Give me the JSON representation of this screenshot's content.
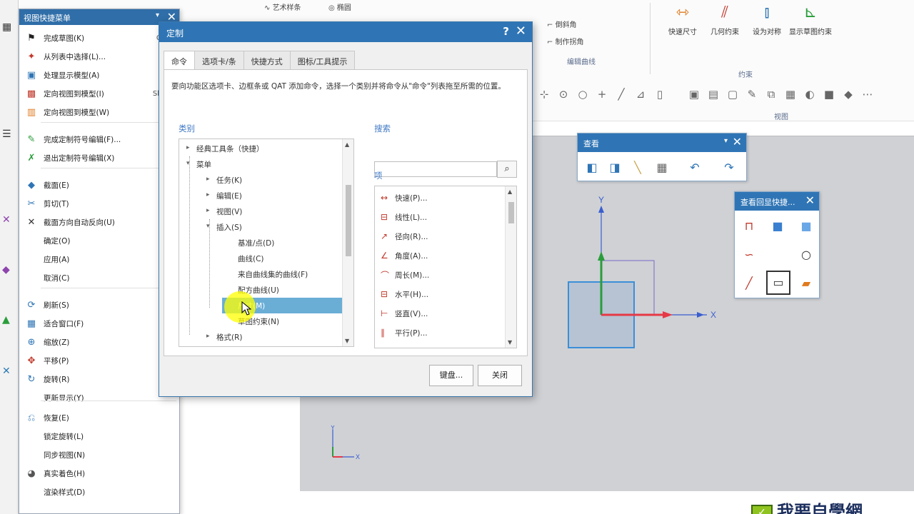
{
  "ribbon": {
    "top_items": [
      "艺术样条",
      "椭圆"
    ],
    "right_items": [
      "倒斜角",
      "制作拐角"
    ],
    "groups": [
      "编辑曲线",
      "约束",
      "视图"
    ],
    "constraint_buttons": [
      "快速尺寸",
      "几何约束",
      "设为对称",
      "显示草图约束"
    ]
  },
  "context_menu": {
    "title": "视图快捷菜单",
    "items": [
      {
        "icon": "flag-icon",
        "label": "完成草图(K)",
        "key": "Ctrl+"
      },
      {
        "icon": "star-icon",
        "label": "从列表中选择(L)...",
        "key": ""
      },
      {
        "icon": "display-icon",
        "label": "处理显示模型(A)",
        "key": ""
      },
      {
        "icon": "view-icon",
        "label": "定向视图到模型(I)",
        "key": "Shift+"
      },
      {
        "icon": "model-icon",
        "label": "定向视图到模型(W)",
        "key": ""
      },
      {
        "icon": "edit-icon",
        "label": "完成定制符号编辑(F)...",
        "key": ""
      },
      {
        "icon": "exit-icon",
        "label": "退出定制符号编辑(X)",
        "key": ""
      },
      {
        "icon": "section-icon",
        "label": "截面(E)",
        "key": ""
      },
      {
        "icon": "cut-icon",
        "label": "剪切(T)",
        "key": ""
      },
      {
        "icon": "cross-icon",
        "label": "截面方向自动反向(U)",
        "key": ""
      },
      {
        "icon": "",
        "label": "确定(O)",
        "key": ""
      },
      {
        "icon": "",
        "label": "应用(A)",
        "key": ""
      },
      {
        "icon": "",
        "label": "取消(C)",
        "key": ""
      },
      {
        "icon": "refresh-icon",
        "label": "刷新(S)",
        "key": ""
      },
      {
        "icon": "fit-icon",
        "label": "适合窗口(F)",
        "key": ""
      },
      {
        "icon": "zoom-icon",
        "label": "缩放(Z)",
        "key": ""
      },
      {
        "icon": "pan-icon",
        "label": "平移(P)",
        "key": ""
      },
      {
        "icon": "rotate-icon",
        "label": "旋转(R)",
        "key": ""
      },
      {
        "icon": "",
        "label": "更新显示(Y)",
        "key": ""
      },
      {
        "icon": "restore-icon",
        "label": "恢复(E)",
        "key": ""
      },
      {
        "icon": "",
        "label": "锁定旋转(L)",
        "key": ""
      },
      {
        "icon": "",
        "label": "同步视图(N)",
        "key": ""
      },
      {
        "icon": "shade-icon",
        "label": "真实着色(H)",
        "key": ""
      },
      {
        "icon": "",
        "label": "渲染样式(D)",
        "key": ""
      }
    ]
  },
  "dialog": {
    "title": "定制",
    "tabs": [
      "命令",
      "选项卡/条",
      "快捷方式",
      "图标/工具提示"
    ],
    "description": "要向功能区选项卡、边框条或 QAT 添加命令，选择一个类别并将命令从\"命令\"列表拖至所需的位置。",
    "category_label": "类别",
    "search_label": "搜索",
    "search_value": "",
    "items_label": "项",
    "categories": [
      {
        "label": "经典工具条（快捷）",
        "level": 1,
        "expander": "+"
      },
      {
        "label": "菜单",
        "level": 1,
        "expander": "-"
      },
      {
        "label": "任务(K)",
        "level": 2,
        "expander": "+"
      },
      {
        "label": "编辑(E)",
        "level": 2,
        "expander": "+"
      },
      {
        "label": "视图(V)",
        "level": 2,
        "expander": "+"
      },
      {
        "label": "插入(S)",
        "level": 2,
        "expander": "-"
      },
      {
        "label": "基准/点(D)",
        "level": 3,
        "expander": ""
      },
      {
        "label": "曲线(C)",
        "level": 3,
        "expander": ""
      },
      {
        "label": "来自曲线集的曲线(F)",
        "level": 3,
        "expander": ""
      },
      {
        "label": "配方曲线(U)",
        "level": 3,
        "expander": ""
      },
      {
        "label": "尺寸(M)",
        "level": 3,
        "expander": "",
        "selected": true
      },
      {
        "label": "草图约束(N)",
        "level": 3,
        "expander": ""
      },
      {
        "label": "格式(R)",
        "level": 2,
        "expander": "+"
      }
    ],
    "items": [
      "快速(P)...",
      "线性(L)...",
      "径向(R)...",
      "角度(A)...",
      "周长(M)...",
      "水平(H)...",
      "竖直(V)...",
      "平行(P)..."
    ],
    "keyboard_button": "键盘...",
    "close_button": "关闭"
  },
  "view_toolbar": {
    "title": "查看",
    "icons": [
      "view-orient-icon",
      "view-cube-icon",
      "measure-icon",
      "grid-icon",
      "undo-icon",
      "redo-icon"
    ]
  },
  "sketch_toolbar": {
    "title": "查看回显快捷...",
    "icons": [
      "profile-icon",
      "box-icon",
      "box-light-icon",
      "arc-icon",
      "circle-icon",
      "line-icon",
      "rectangle-icon",
      "color-bars-icon"
    ]
  },
  "graphics": {
    "axis_x": "X",
    "axis_y": "Y"
  },
  "watermark": {
    "text": "我要自學網"
  },
  "colors": {
    "title_bar": "#2f75b5",
    "selection": "#6aaed6",
    "graphics_bg": "#cfd1d5",
    "axis_x": "#e63946",
    "axis_y": "#2a9d3b",
    "axis_z": "#3a5ecf"
  }
}
